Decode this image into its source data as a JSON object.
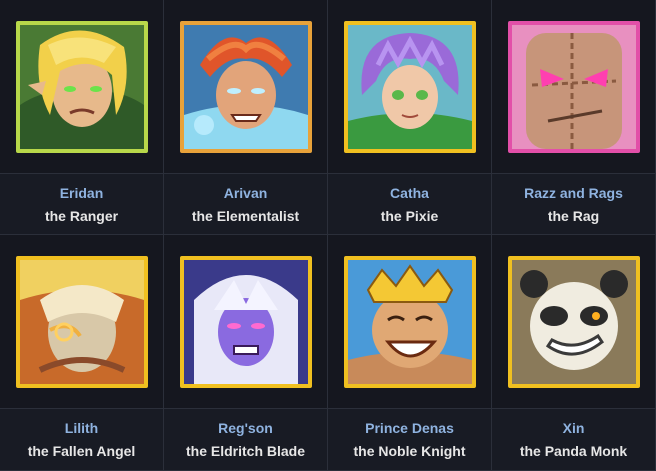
{
  "heroes": [
    {
      "name": "Eridan",
      "title": "the Ranger",
      "frame": "#b8d84a",
      "icon": "eridan-portrait-icon"
    },
    {
      "name": "Arivan",
      "title": "the Elementalist",
      "frame": "#e8a23a",
      "icon": "arivan-portrait-icon"
    },
    {
      "name": "Catha",
      "title": "the Pixie",
      "frame": "#f0c020",
      "icon": "catha-portrait-icon"
    },
    {
      "name": "Razz and Rags",
      "title": "the Rag",
      "frame": "#e24fa8",
      "icon": "razz-and-rags-portrait-icon"
    },
    {
      "name": "Lilith",
      "title": "the Fallen Angel",
      "frame": "#f0c020",
      "icon": "lilith-portrait-icon"
    },
    {
      "name": "Reg'son",
      "title": "the Eldritch Blade",
      "frame": "#f0c020",
      "icon": "regson-portrait-icon"
    },
    {
      "name": "Prince Denas",
      "title": "the Noble Knight",
      "frame": "#f0c020",
      "icon": "prince-denas-portrait-icon"
    },
    {
      "name": "Xin",
      "title": "the Panda Monk",
      "frame": "#f0c020",
      "icon": "xin-portrait-icon"
    }
  ]
}
